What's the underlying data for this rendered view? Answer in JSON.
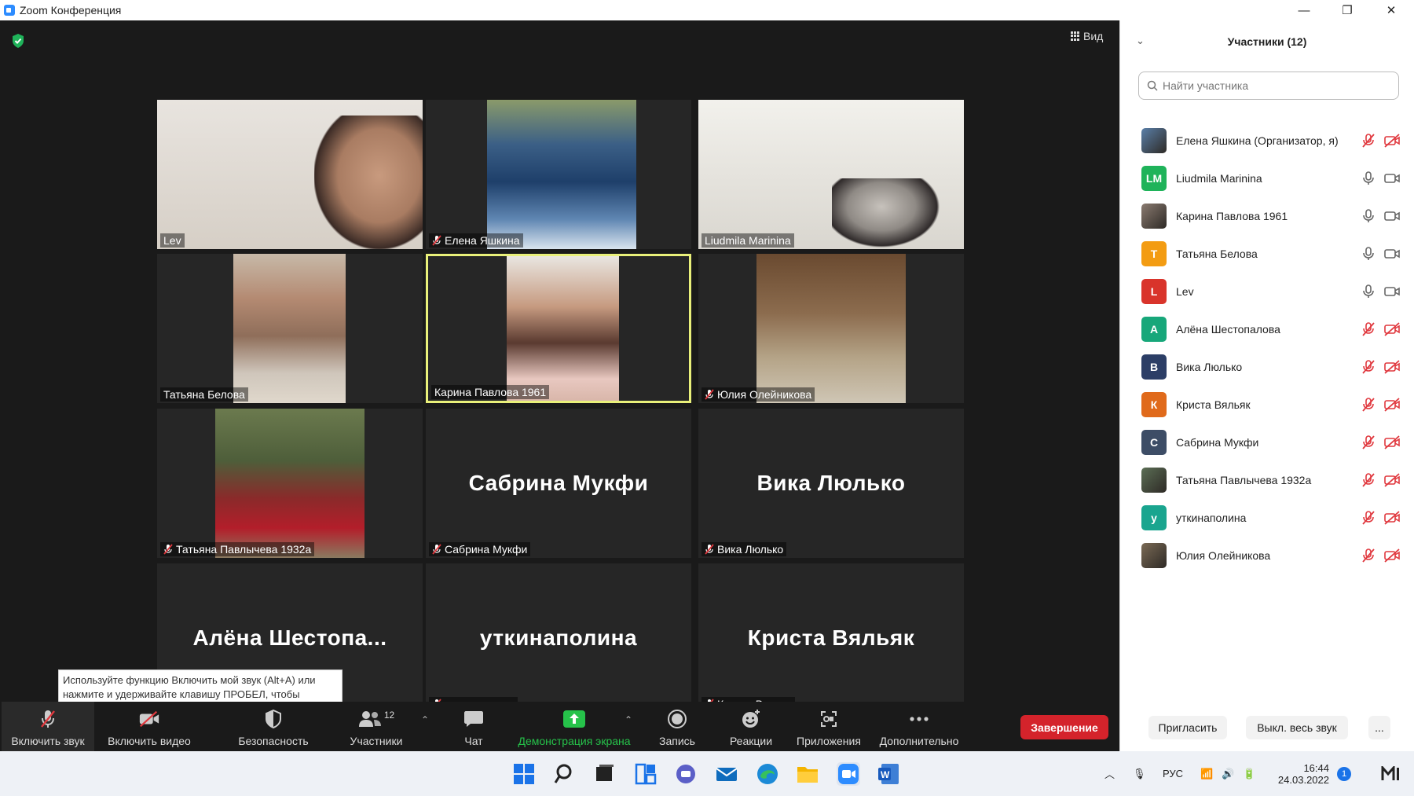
{
  "window": {
    "title": "Zoom Конференция"
  },
  "stage": {
    "view_label": "Вид"
  },
  "tiles": [
    {
      "name": "Lev",
      "big": "",
      "muted": false,
      "video": "lev"
    },
    {
      "name": "Елена Яшкина",
      "big": "",
      "muted": true,
      "video": "river"
    },
    {
      "name": "Liudmila Marinina",
      "big": "",
      "muted": false,
      "video": "room"
    },
    {
      "name": "Татьяна Белова",
      "big": "",
      "muted": false,
      "video": "woman1"
    },
    {
      "name": "Карина Павлова 1961",
      "big": "",
      "muted": false,
      "video": "woman2"
    },
    {
      "name": "Юлия Олейникова",
      "big": "",
      "muted": true,
      "video": "stairs"
    },
    {
      "name": "Татьяна Павлычева 1932а",
      "big": "",
      "muted": true,
      "video": "red"
    },
    {
      "name": "Сабрина Мукфи",
      "big": "Сабрина Мукфи",
      "muted": true,
      "video": ""
    },
    {
      "name": "Вика Люлько",
      "big": "Вика Люлько",
      "muted": true,
      "video": ""
    },
    {
      "name": "",
      "big": "Алёна  Шестопа...",
      "muted": false,
      "video": ""
    },
    {
      "name": "уткинаполина",
      "big": "уткинаполина",
      "muted": true,
      "video": ""
    },
    {
      "name": "Криста Вяльяк",
      "big": "Криста Вяльяк",
      "muted": true,
      "video": ""
    }
  ],
  "tooltip": {
    "text": "Используйте функцию Включить мой звук (Alt+A) или нажмите и удерживайте клавишу ПРОБЕЛ, чтобы временно включить звук."
  },
  "toolbar": {
    "unmute": "Включить звук",
    "start_video": "Включить видео",
    "security": "Безопасность",
    "participants": "Участники",
    "participants_count": "12",
    "chat": "Чат",
    "share": "Демонстрация экрана",
    "record": "Запись",
    "reactions": "Реакции",
    "apps": "Приложения",
    "more": "Дополнительно",
    "end": "Завершение"
  },
  "panel": {
    "title": "Участники (12)",
    "search_placeholder": "Найти участника",
    "participants": [
      {
        "name": "Елена Яшкина (Организатор, я)",
        "initials": "",
        "color": "#5a7fa8",
        "photo": true,
        "muted": true,
        "cam_off": true
      },
      {
        "name": "Liudmila Marinina",
        "initials": "LM",
        "color": "#1fb35a",
        "photo": false,
        "muted": false,
        "cam_off": false
      },
      {
        "name": "Карина Павлова 1961",
        "initials": "",
        "color": "#8a7a70",
        "photo": true,
        "muted": false,
        "cam_off": false
      },
      {
        "name": "Татьяна Белова",
        "initials": "Т",
        "color": "#f39c12",
        "photo": false,
        "muted": false,
        "cam_off": false
      },
      {
        "name": "Lev",
        "initials": "L",
        "color": "#d9342b",
        "photo": false,
        "muted": false,
        "cam_off": false
      },
      {
        "name": "Алёна Шестопалова",
        "initials": "А",
        "color": "#17a77a",
        "photo": false,
        "muted": true,
        "cam_off": true
      },
      {
        "name": "Вика Люлько",
        "initials": "В",
        "color": "#2c3e66",
        "photo": false,
        "muted": true,
        "cam_off": true
      },
      {
        "name": "Криста Вяльяк",
        "initials": "К",
        "color": "#e06a1b",
        "photo": false,
        "muted": true,
        "cam_off": true
      },
      {
        "name": "Сабрина Мукфи",
        "initials": "С",
        "color": "#3d4d66",
        "photo": false,
        "muted": true,
        "cam_off": true
      },
      {
        "name": "Татьяна Павлычева 1932а",
        "initials": "",
        "color": "#5b6e55",
        "photo": true,
        "muted": true,
        "cam_off": true
      },
      {
        "name": "уткинаполина",
        "initials": "у",
        "color": "#1aa58f",
        "photo": false,
        "muted": true,
        "cam_off": true
      },
      {
        "name": "Юлия Олейникова",
        "initials": "",
        "color": "#7a6a55",
        "photo": true,
        "muted": true,
        "cam_off": true
      }
    ],
    "invite": "Пригласить",
    "mute_all": "Выкл. весь звук",
    "more": "..."
  },
  "taskbar": {
    "lang": "РУС",
    "time": "16:44",
    "date": "24.03.2022",
    "notif_count": "1"
  }
}
